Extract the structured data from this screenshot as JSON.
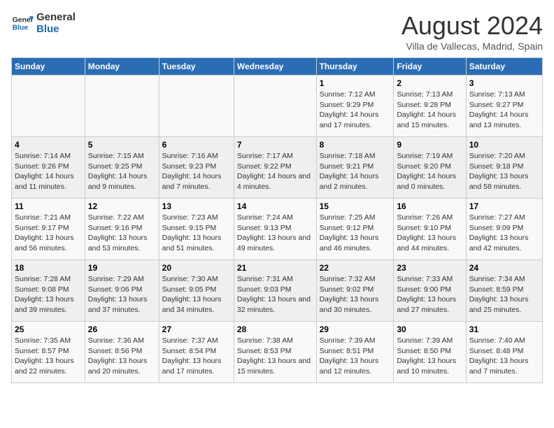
{
  "logo": {
    "line1": "General",
    "line2": "Blue"
  },
  "title": "August 2024",
  "subtitle": "Villa de Vallecas, Madrid, Spain",
  "days_of_week": [
    "Sunday",
    "Monday",
    "Tuesday",
    "Wednesday",
    "Thursday",
    "Friday",
    "Saturday"
  ],
  "weeks": [
    [
      {
        "day": "",
        "info": ""
      },
      {
        "day": "",
        "info": ""
      },
      {
        "day": "",
        "info": ""
      },
      {
        "day": "",
        "info": ""
      },
      {
        "day": "1",
        "info": "Sunrise: 7:12 AM\nSunset: 9:29 PM\nDaylight: 14 hours and 17 minutes."
      },
      {
        "day": "2",
        "info": "Sunrise: 7:13 AM\nSunset: 9:28 PM\nDaylight: 14 hours and 15 minutes."
      },
      {
        "day": "3",
        "info": "Sunrise: 7:13 AM\nSunset: 9:27 PM\nDaylight: 14 hours and 13 minutes."
      }
    ],
    [
      {
        "day": "4",
        "info": "Sunrise: 7:14 AM\nSunset: 9:26 PM\nDaylight: 14 hours and 11 minutes."
      },
      {
        "day": "5",
        "info": "Sunrise: 7:15 AM\nSunset: 9:25 PM\nDaylight: 14 hours and 9 minutes."
      },
      {
        "day": "6",
        "info": "Sunrise: 7:16 AM\nSunset: 9:23 PM\nDaylight: 14 hours and 7 minutes."
      },
      {
        "day": "7",
        "info": "Sunrise: 7:17 AM\nSunset: 9:22 PM\nDaylight: 14 hours and 4 minutes."
      },
      {
        "day": "8",
        "info": "Sunrise: 7:18 AM\nSunset: 9:21 PM\nDaylight: 14 hours and 2 minutes."
      },
      {
        "day": "9",
        "info": "Sunrise: 7:19 AM\nSunset: 9:20 PM\nDaylight: 14 hours and 0 minutes."
      },
      {
        "day": "10",
        "info": "Sunrise: 7:20 AM\nSunset: 9:18 PM\nDaylight: 13 hours and 58 minutes."
      }
    ],
    [
      {
        "day": "11",
        "info": "Sunrise: 7:21 AM\nSunset: 9:17 PM\nDaylight: 13 hours and 56 minutes."
      },
      {
        "day": "12",
        "info": "Sunrise: 7:22 AM\nSunset: 9:16 PM\nDaylight: 13 hours and 53 minutes."
      },
      {
        "day": "13",
        "info": "Sunrise: 7:23 AM\nSunset: 9:15 PM\nDaylight: 13 hours and 51 minutes."
      },
      {
        "day": "14",
        "info": "Sunrise: 7:24 AM\nSunset: 9:13 PM\nDaylight: 13 hours and 49 minutes."
      },
      {
        "day": "15",
        "info": "Sunrise: 7:25 AM\nSunset: 9:12 PM\nDaylight: 13 hours and 46 minutes."
      },
      {
        "day": "16",
        "info": "Sunrise: 7:26 AM\nSunset: 9:10 PM\nDaylight: 13 hours and 44 minutes."
      },
      {
        "day": "17",
        "info": "Sunrise: 7:27 AM\nSunset: 9:09 PM\nDaylight: 13 hours and 42 minutes."
      }
    ],
    [
      {
        "day": "18",
        "info": "Sunrise: 7:28 AM\nSunset: 9:08 PM\nDaylight: 13 hours and 39 minutes."
      },
      {
        "day": "19",
        "info": "Sunrise: 7:29 AM\nSunset: 9:06 PM\nDaylight: 13 hours and 37 minutes."
      },
      {
        "day": "20",
        "info": "Sunrise: 7:30 AM\nSunset: 9:05 PM\nDaylight: 13 hours and 34 minutes."
      },
      {
        "day": "21",
        "info": "Sunrise: 7:31 AM\nSunset: 9:03 PM\nDaylight: 13 hours and 32 minutes."
      },
      {
        "day": "22",
        "info": "Sunrise: 7:32 AM\nSunset: 9:02 PM\nDaylight: 13 hours and 30 minutes."
      },
      {
        "day": "23",
        "info": "Sunrise: 7:33 AM\nSunset: 9:00 PM\nDaylight: 13 hours and 27 minutes."
      },
      {
        "day": "24",
        "info": "Sunrise: 7:34 AM\nSunset: 8:59 PM\nDaylight: 13 hours and 25 minutes."
      }
    ],
    [
      {
        "day": "25",
        "info": "Sunrise: 7:35 AM\nSunset: 8:57 PM\nDaylight: 13 hours and 22 minutes."
      },
      {
        "day": "26",
        "info": "Sunrise: 7:36 AM\nSunset: 8:56 PM\nDaylight: 13 hours and 20 minutes."
      },
      {
        "day": "27",
        "info": "Sunrise: 7:37 AM\nSunset: 8:54 PM\nDaylight: 13 hours and 17 minutes."
      },
      {
        "day": "28",
        "info": "Sunrise: 7:38 AM\nSunset: 8:53 PM\nDaylight: 13 hours and 15 minutes."
      },
      {
        "day": "29",
        "info": "Sunrise: 7:39 AM\nSunset: 8:51 PM\nDaylight: 13 hours and 12 minutes."
      },
      {
        "day": "30",
        "info": "Sunrise: 7:39 AM\nSunset: 8:50 PM\nDaylight: 13 hours and 10 minutes."
      },
      {
        "day": "31",
        "info": "Sunrise: 7:40 AM\nSunset: 8:48 PM\nDaylight: 13 hours and 7 minutes."
      }
    ]
  ]
}
